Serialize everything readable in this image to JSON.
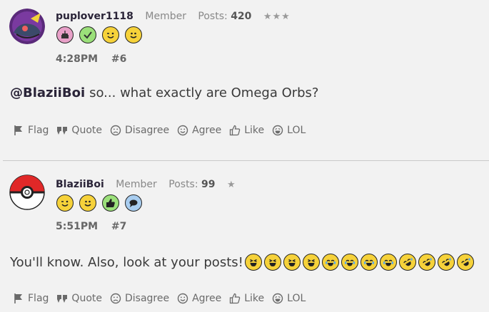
{
  "posts": [
    {
      "username": "puplover1118",
      "role": "Member",
      "posts_label": "Posts:",
      "posts_count": "420",
      "stars": "★★★",
      "badges": [
        "birthday-cake-badge",
        "check-badge",
        "wink-badge",
        "smile-badge"
      ],
      "time": "4:28PM",
      "number": "#6",
      "mention": "@BlaziiBoi",
      "text": "so... what exactly are Omega Orbs?",
      "emojis": [],
      "actions": [
        "Flag",
        "Quote",
        "Disagree",
        "Agree",
        "Like",
        "LOL"
      ]
    },
    {
      "username": "BlaziiBoi",
      "role": "Member",
      "posts_label": "Posts:",
      "posts_count": "99",
      "stars": "★",
      "badges": [
        "wink-badge",
        "smile-badge",
        "thumbs-up-badge",
        "speech-bubble-badge"
      ],
      "time": "5:51PM",
      "number": "#7",
      "mention": "",
      "text": "You'll know. Also, look at your posts!",
      "emojis": [
        "squint-laugh",
        "squint-laugh",
        "squint-laugh",
        "squint-laugh",
        "tears-of-joy",
        "tears-of-joy",
        "tears-of-joy",
        "tears-of-joy",
        "rolling-laugh",
        "rolling-laugh",
        "rolling-laugh",
        "rolling-laugh"
      ],
      "actions": [
        "Flag",
        "Quote",
        "Disagree",
        "Agree",
        "Like",
        "LOL"
      ]
    }
  ],
  "colors": {
    "background": "#f2f2f2",
    "username": "#2a2438",
    "muted": "#888888",
    "action": "#6a6a6a",
    "emoji_yellow": "#f6d23a",
    "badge_pink": "#e8a0c8",
    "badge_green": "#9be07a",
    "badge_blue": "#a8cdf0"
  }
}
